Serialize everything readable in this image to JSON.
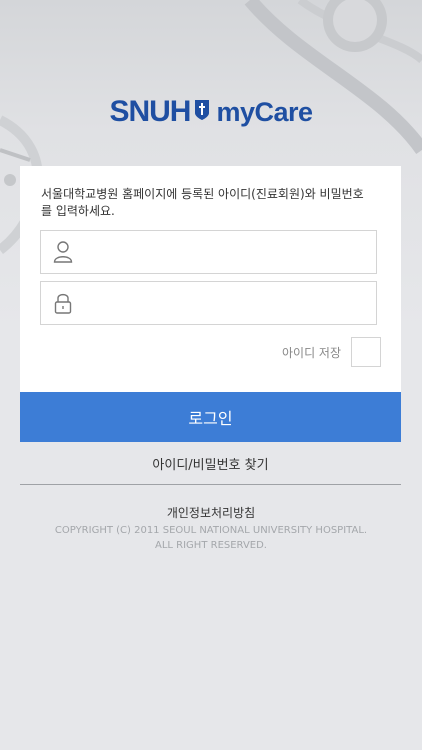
{
  "brand": {
    "name_left": "SNUH",
    "name_right": "myCare",
    "color": "#1f4fa2",
    "emblem_icon": "snuh-emblem-icon"
  },
  "login_form": {
    "description": "서울대학교병원 홈페이지에 등록된 아이디(진료회원)와 비밀번호를 입력하세요.",
    "id_field": {
      "value": "",
      "placeholder": "",
      "icon": "user-icon"
    },
    "password_field": {
      "value": "",
      "placeholder": "",
      "icon": "lock-icon"
    },
    "remember_label": "아이디 저장",
    "remember_checked": false
  },
  "actions": {
    "login_label": "로그인",
    "login_color": "#3d7dd6",
    "find_account_label": "아이디/비밀번호 찾기"
  },
  "footer": {
    "privacy_label": "개인정보처리방침",
    "copyright_line1": "COPYRIGHT (C) 2011 SEOUL NATIONAL UNIVERSITY HOSPITAL.",
    "copyright_line2": "ALL RIGHT RESERVED."
  }
}
